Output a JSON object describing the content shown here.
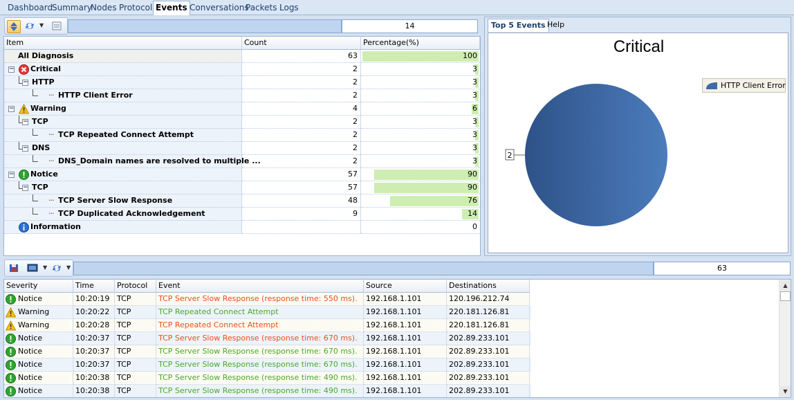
{
  "tabs": [
    "Dashboard",
    "Summary",
    "Nodes",
    "Protocol",
    "Events",
    "Conversations",
    "Packets",
    "Logs"
  ],
  "active_tab": "Events",
  "top_count": "14",
  "tree": {
    "headers": [
      "Item",
      "Count",
      "Percentage(%)"
    ],
    "rows": [
      {
        "label": "All Diagnosis",
        "count": "63",
        "pct": "100",
        "pct_value": 100,
        "level": 0,
        "icon": "none"
      },
      {
        "label": "Critical",
        "count": "2",
        "pct": "3",
        "pct_value": 3,
        "level": 0,
        "icon": "critical-icon"
      },
      {
        "label": "HTTP",
        "count": "2",
        "pct": "3",
        "pct_value": 3,
        "level": 1,
        "icon": "none"
      },
      {
        "label": "HTTP Client Error",
        "count": "2",
        "pct": "3",
        "pct_value": 3,
        "level": 2,
        "icon": "none"
      },
      {
        "label": "Warning",
        "count": "4",
        "pct": "6",
        "pct_value": 6,
        "level": 0,
        "icon": "warning-icon"
      },
      {
        "label": "TCP",
        "count": "2",
        "pct": "3",
        "pct_value": 3,
        "level": 1,
        "icon": "none"
      },
      {
        "label": "TCP Repeated Connect Attempt",
        "count": "2",
        "pct": "3",
        "pct_value": 3,
        "level": 2,
        "icon": "none"
      },
      {
        "label": "DNS",
        "count": "2",
        "pct": "3",
        "pct_value": 3,
        "level": 1,
        "icon": "none"
      },
      {
        "label": "DNS_Domain names are resolved to multiple ...",
        "count": "2",
        "pct": "3",
        "pct_value": 3,
        "level": 2,
        "icon": "none"
      },
      {
        "label": "Notice",
        "count": "57",
        "pct": "90",
        "pct_value": 90,
        "level": 0,
        "icon": "notice-icon"
      },
      {
        "label": "TCP",
        "count": "57",
        "pct": "90",
        "pct_value": 90,
        "level": 1,
        "icon": "none"
      },
      {
        "label": "TCP Server Slow Response",
        "count": "48",
        "pct": "76",
        "pct_value": 76,
        "level": 2,
        "icon": "none"
      },
      {
        "label": "TCP Duplicated Acknowledgement",
        "count": "9",
        "pct": "14",
        "pct_value": 14,
        "level": 2,
        "icon": "none"
      },
      {
        "label": "Information",
        "count": "",
        "pct": "0",
        "pct_value": 0,
        "level": 0,
        "icon": "info-icon"
      }
    ]
  },
  "right_tabs": [
    "Top 5 Events",
    "Help"
  ],
  "chart_data": {
    "type": "pie",
    "title": "Critical",
    "categories": [
      "HTTP Client Error"
    ],
    "values": [
      2
    ],
    "legend": "top-right",
    "colors": [
      "#3f69a6"
    ]
  },
  "bottom_count": "63",
  "events": {
    "headers": [
      "Severity",
      "Time",
      "Protocol",
      "Event",
      "Source",
      "Destinations"
    ],
    "rows": [
      {
        "severity": "Notice",
        "time": "10:20:19",
        "protocol": "TCP",
        "event": "TCP Server Slow Response (response time: 550 ms).",
        "source": "192.168.1.101",
        "dest": "120.196.212.74",
        "color": "#e8501c"
      },
      {
        "severity": "Warning",
        "time": "10:20:22",
        "protocol": "TCP",
        "event": "TCP Repeated Connect Attempt",
        "source": "192.168.1.101",
        "dest": "220.181.126.81",
        "color": "#4aa82a"
      },
      {
        "severity": "Warning",
        "time": "10:20:28",
        "protocol": "TCP",
        "event": "TCP Repeated Connect Attempt",
        "source": "192.168.1.101",
        "dest": "220.181.126.81",
        "color": "#e8501c"
      },
      {
        "severity": "Notice",
        "time": "10:20:37",
        "protocol": "TCP",
        "event": "TCP Server Slow Response (response time: 670 ms).",
        "source": "192.168.1.101",
        "dest": "202.89.233.101",
        "color": "#e8501c"
      },
      {
        "severity": "Notice",
        "time": "10:20:37",
        "protocol": "TCP",
        "event": "TCP Server Slow Response (response time: 670 ms).",
        "source": "192.168.1.101",
        "dest": "202.89.233.101",
        "color": "#4aa82a"
      },
      {
        "severity": "Notice",
        "time": "10:20:37",
        "protocol": "TCP",
        "event": "TCP Server Slow Response (response time: 670 ms).",
        "source": "192.168.1.101",
        "dest": "202.89.233.101",
        "color": "#4aa82a"
      },
      {
        "severity": "Notice",
        "time": "10:20:38",
        "protocol": "TCP",
        "event": "TCP Server Slow Response (response time: 490 ms).",
        "source": "192.168.1.101",
        "dest": "202.89.233.101",
        "color": "#4aa82a"
      },
      {
        "severity": "Notice",
        "time": "10:20:38",
        "protocol": "TCP",
        "event": "TCP Server Slow Response (response time: 490 ms).",
        "source": "192.168.1.101",
        "dest": "202.89.233.101",
        "color": "#4aa82a"
      }
    ]
  }
}
